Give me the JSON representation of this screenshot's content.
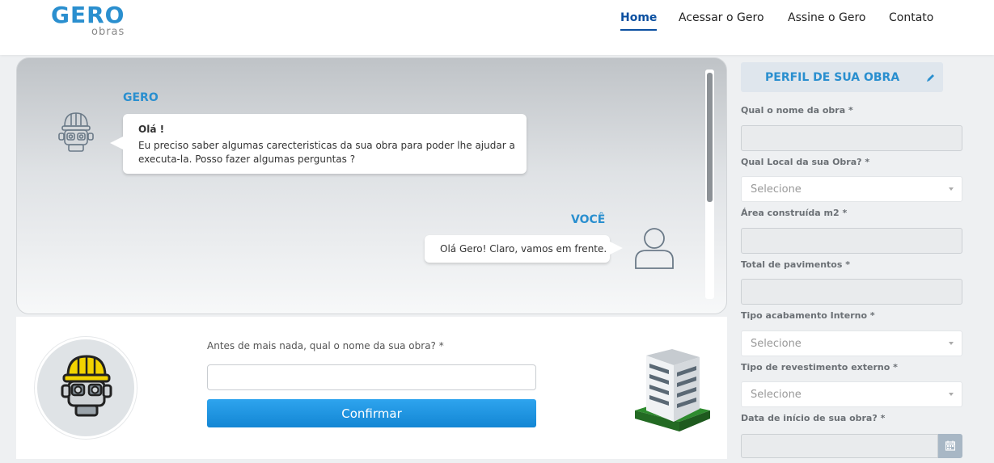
{
  "header": {
    "logo_main": "GERO",
    "logo_sub": "obras",
    "nav": [
      "Home",
      "Acessar o Gero",
      "Assine o Gero",
      "Contato"
    ],
    "active_nav": "Home"
  },
  "chat": {
    "bot_name": "GERO",
    "bot_greeting": "Olá !",
    "bot_message_line1": "Eu preciso saber algumas carecteristicas da sua obra para poder lhe ajudar a",
    "bot_message_line2": "executa-la. Posso fazer algumas perguntas ?",
    "user_name": "VOCÊ",
    "user_message": "Olá Gero! Claro, vamos em frente."
  },
  "question": {
    "label": "Antes de mais nada, qual o nome da sua obra? *",
    "input_value": "",
    "button_label": "Confirmar"
  },
  "profile_form": {
    "title": "PERFIL DE SUA OBRA",
    "fields": [
      {
        "label": "Qual o nome da obra *",
        "type": "text",
        "value": ""
      },
      {
        "label": "Qual Local da sua Obra? *",
        "type": "select",
        "value": "Selecione"
      },
      {
        "label": "Área construída m2 *",
        "type": "text",
        "value": ""
      },
      {
        "label": "Total de pavimentos *",
        "type": "text",
        "value": ""
      },
      {
        "label": "Tipo acabamento Interno *",
        "type": "select",
        "value": "Selecione"
      },
      {
        "label": "Tipo de revestimento externo *",
        "type": "select",
        "value": "Selecione"
      },
      {
        "label": "Data de início de sua obra? *",
        "type": "date",
        "value": ""
      }
    ]
  },
  "colors": {
    "brand_blue": "#2a8fcf",
    "nav_active": "#0a4fa0",
    "button_blue": "#1a96e2"
  },
  "icons": [
    "robot-icon",
    "user-icon",
    "pencil-icon",
    "building-icon",
    "calendar-icon",
    "chevron-down-icon"
  ]
}
